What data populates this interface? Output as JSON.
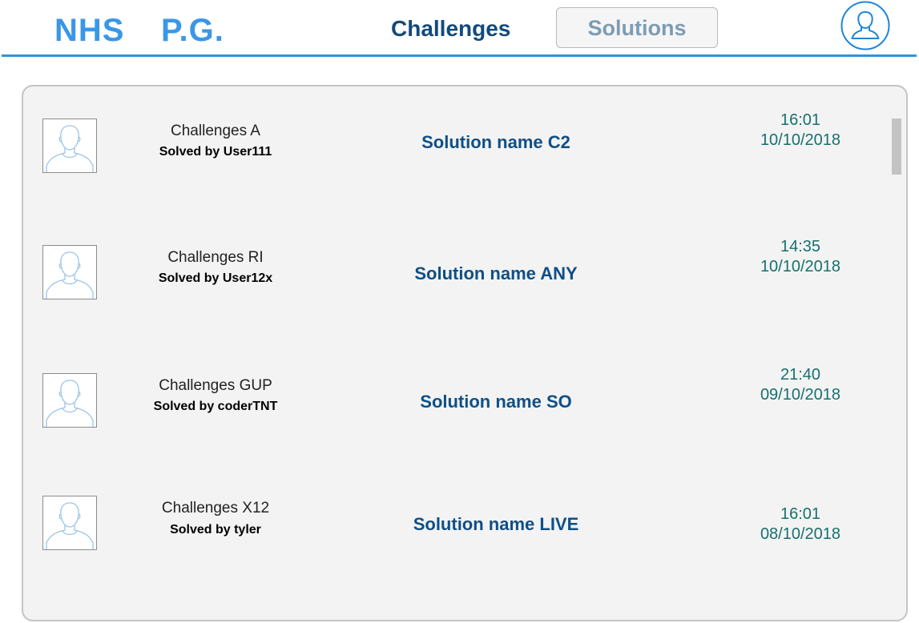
{
  "header": {
    "logo_left": "NHS",
    "logo_right": "P.G.",
    "tabs": [
      {
        "label": "Challenges",
        "active": true
      },
      {
        "label": "Solutions",
        "active": false
      }
    ],
    "profile_icon": "user-profile-icon"
  },
  "colors": {
    "brand": "#3a97e8",
    "active_tab": "#124b7c",
    "inactive_tab": "#7d9cb4",
    "solution_text": "#0f4f85",
    "timestamp": "#17706e",
    "rule": "#2f94dc"
  },
  "rows": [
    {
      "avatar_icon": "user-avatar-icon",
      "challenge": "Challenges A",
      "solved_by": "Solved by User111",
      "solution": "Solution name C2",
      "time": "16:01",
      "date": "10/10/2018"
    },
    {
      "avatar_icon": "user-avatar-icon",
      "challenge": "Challenges RI",
      "solved_by": "Solved by User12x",
      "solution": "Solution name ANY",
      "time": "14:35",
      "date": "10/10/2018"
    },
    {
      "avatar_icon": "user-avatar-icon",
      "challenge": "Challenges GUP",
      "solved_by": "Solved by coderTNT",
      "solution": "Solution name SO",
      "time": "21:40",
      "date": "09/10/2018"
    },
    {
      "avatar_icon": "user-avatar-icon",
      "challenge": "Challenges X12",
      "solved_by": "Solved by tyler",
      "solution": "Solution name LIVE",
      "time": "16:01",
      "date": "08/10/2018"
    }
  ]
}
